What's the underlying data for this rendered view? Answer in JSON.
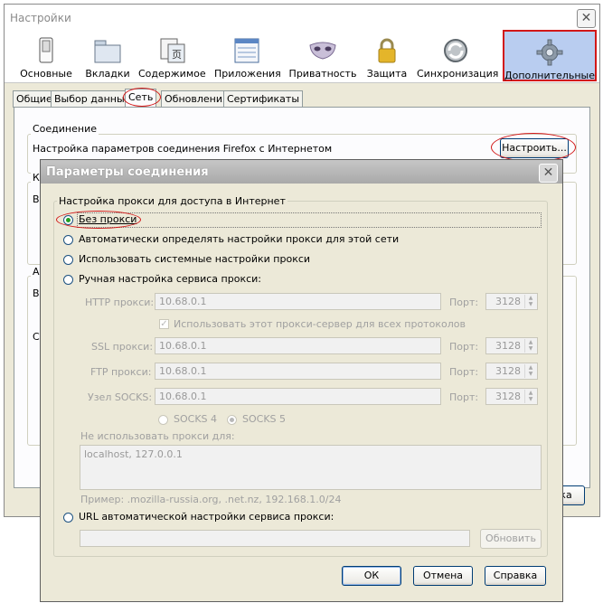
{
  "window": {
    "title": "Настройки",
    "close": "✕"
  },
  "panes": [
    {
      "label": "Основные"
    },
    {
      "label": "Вкладки"
    },
    {
      "label": "Содержимое"
    },
    {
      "label": "Приложения"
    },
    {
      "label": "Приватность"
    },
    {
      "label": "Защита"
    },
    {
      "label": "Синхронизация"
    },
    {
      "label": "Дополнительные"
    }
  ],
  "tabs": [
    "Общие",
    "Выбор данных",
    "Сеть",
    "Обновления",
    "Сертификаты"
  ],
  "connection": {
    "group_title": "Соединение",
    "description": "Настройка параметров соединения Firefox с Интернетом",
    "button": "Настроить..."
  },
  "background_fragments": {
    "group2_title": "Ка",
    "row1": "Ва",
    "group3_title": "Ав",
    "row2": "Ва",
    "row3": "Сі",
    "button_tail": "ка"
  },
  "dialog": {
    "title": "Параметры соединения",
    "close": "✕",
    "group_title": "Настройка прокси для доступа в Интернет",
    "options": [
      {
        "label": "Без прокси",
        "selected": true
      },
      {
        "label": "Автоматически определять настройки прокси для этой сети",
        "selected": false
      },
      {
        "label": "Использовать системные настройки прокси",
        "selected": false
      },
      {
        "label": "Ручная настройка сервиса прокси:",
        "selected": false
      }
    ],
    "manual": {
      "http_label": "HTTP прокси:",
      "http_value": "10.68.0.1",
      "http_port": "3128",
      "same_proxy_label": "Использовать этот прокси-сервер для всех протоколов",
      "same_proxy_checked": true,
      "ssl_label": "SSL прокси:",
      "ssl_value": "10.68.0.1",
      "ssl_port": "3128",
      "ftp_label": "FTP прокси:",
      "ftp_value": "10.68.0.1",
      "ftp_port": "3128",
      "socks_label": "Узел SOCKS:",
      "socks_value": "10.68.0.1",
      "socks_port": "3128",
      "port_label": "Порт:",
      "socks4": "SOCKS 4",
      "socks5": "SOCKS 5",
      "no_proxy_label": "Не использовать прокси для:",
      "no_proxy_value": "localhost, 127.0.0.1",
      "example": "Пример: .mozilla-russia.org, .net.nz, 192.168.1.0/24"
    },
    "auto_url_label": "URL автоматической настройки сервиса прокси:",
    "auto_url_value": "",
    "reload_button": "Обновить",
    "ok": "ОК",
    "cancel": "Отмена",
    "help": "Справка"
  },
  "colors": {
    "highlight": "#d21818",
    "selected_pane": "#b9cdf0",
    "dialog_bg": "#ece9d8"
  }
}
